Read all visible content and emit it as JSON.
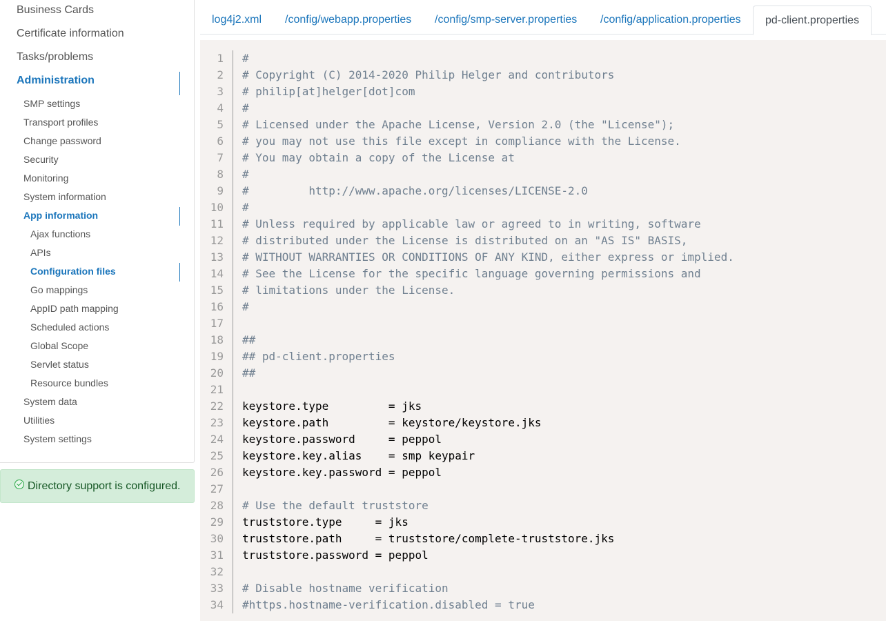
{
  "sidebar": {
    "items": [
      {
        "label": "Business Cards",
        "level": 1,
        "active": false
      },
      {
        "label": "Certificate information",
        "level": 1,
        "active": false
      },
      {
        "label": "Tasks/problems",
        "level": 1,
        "active": false
      },
      {
        "label": "Administration",
        "level": 1,
        "active": true
      },
      {
        "label": "SMP settings",
        "level": 2,
        "active": false
      },
      {
        "label": "Transport profiles",
        "level": 2,
        "active": false
      },
      {
        "label": "Change password",
        "level": 2,
        "active": false
      },
      {
        "label": "Security",
        "level": 2,
        "active": false
      },
      {
        "label": "Monitoring",
        "level": 2,
        "active": false
      },
      {
        "label": "System information",
        "level": 2,
        "active": false
      },
      {
        "label": "App information",
        "level": 2,
        "active": true
      },
      {
        "label": "Ajax functions",
        "level": 3,
        "active": false
      },
      {
        "label": "APIs",
        "level": 3,
        "active": false
      },
      {
        "label": "Configuration files",
        "level": 3,
        "active": true
      },
      {
        "label": "Go mappings",
        "level": 3,
        "active": false
      },
      {
        "label": "AppID path mapping",
        "level": 3,
        "active": false
      },
      {
        "label": "Scheduled actions",
        "level": 3,
        "active": false
      },
      {
        "label": "Global Scope",
        "level": 3,
        "active": false
      },
      {
        "label": "Servlet status",
        "level": 3,
        "active": false
      },
      {
        "label": "Resource bundles",
        "level": 3,
        "active": false
      },
      {
        "label": "System data",
        "level": 2,
        "active": false
      },
      {
        "label": "Utilities",
        "level": 2,
        "active": false
      },
      {
        "label": "System settings",
        "level": 2,
        "active": false
      }
    ]
  },
  "alert": {
    "text": "Directory support is configured.",
    "icon": "check-circle-icon"
  },
  "tabs": [
    {
      "label": "log4j2.xml",
      "active": false
    },
    {
      "label": "/config/webapp.properties",
      "active": false
    },
    {
      "label": "/config/smp-server.properties",
      "active": false
    },
    {
      "label": "/config/application.properties",
      "active": false
    },
    {
      "label": "pd-client.properties",
      "active": true
    }
  ],
  "code": {
    "lines": [
      "#",
      "# Copyright (C) 2014-2020 Philip Helger and contributors",
      "# philip[at]helger[dot]com",
      "#",
      "# Licensed under the Apache License, Version 2.0 (the \"License\");",
      "# you may not use this file except in compliance with the License.",
      "# You may obtain a copy of the License at",
      "#",
      "#         http://www.apache.org/licenses/LICENSE-2.0",
      "#",
      "# Unless required by applicable law or agreed to in writing, software",
      "# distributed under the License is distributed on an \"AS IS\" BASIS,",
      "# WITHOUT WARRANTIES OR CONDITIONS OF ANY KIND, either express or implied.",
      "# See the License for the specific language governing permissions and",
      "# limitations under the License.",
      "#",
      "",
      "##",
      "## pd-client.properties",
      "##",
      "",
      "keystore.type         = jks",
      "keystore.path         = keystore/keystore.jks",
      "keystore.password     = peppol",
      "keystore.key.alias    = smp keypair",
      "keystore.key.password = peppol",
      "",
      "# Use the default truststore",
      "truststore.type     = jks",
      "truststore.path     = truststore/complete-truststore.jks",
      "truststore.password = peppol",
      "",
      "# Disable hostname verification",
      "#https.hostname-verification.disabled = true"
    ]
  }
}
